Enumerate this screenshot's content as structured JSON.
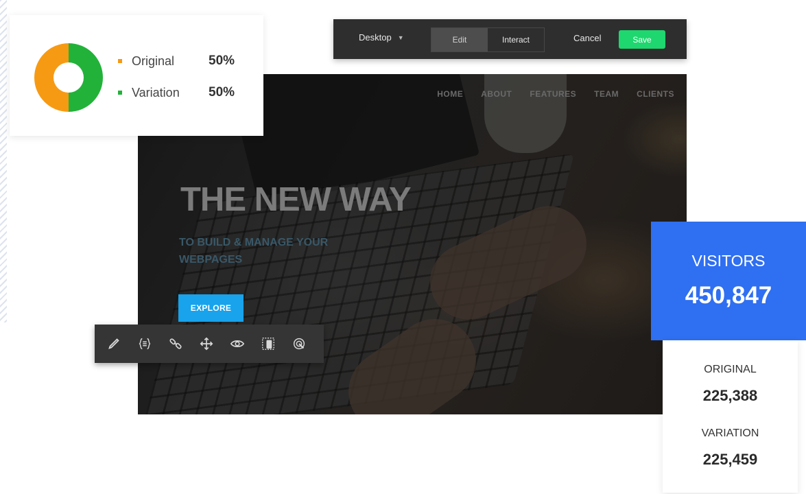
{
  "split_test": {
    "items": [
      {
        "label": "Original",
        "value": "50%",
        "color": "#f79a13"
      },
      {
        "label": "Variation",
        "value": "50%",
        "color": "#22b23a"
      }
    ]
  },
  "editor": {
    "device": "Desktop",
    "modes": [
      "Edit",
      "Interact"
    ],
    "active_mode": "Edit",
    "cancel_label": "Cancel",
    "save_label": "Save",
    "save_color": "#1ed76e"
  },
  "website": {
    "nav": [
      "HOME",
      "ABOUT",
      "FEATURES",
      "TEAM",
      "CLIENTS"
    ],
    "hero_title": "THE NEW WAY",
    "hero_subtitle_line1": "TO BUILD & MANAGE YOUR",
    "hero_subtitle_line2": "WEBPAGES",
    "cta_label": "EXPLORE",
    "cta_color": "#18a3ec"
  },
  "toolbar": {
    "tools": [
      "pencil-icon",
      "code-braces-icon",
      "link-icon",
      "move-icon",
      "eye-icon",
      "select-mobile-icon",
      "cursor-target-icon"
    ]
  },
  "visitors": {
    "label": "VISITORS",
    "value": "450,847",
    "color": "#2f6ff1",
    "original_label": "ORIGINAL",
    "original_value": "225,388",
    "variation_label": "VARIATION",
    "variation_value": "225,459"
  }
}
